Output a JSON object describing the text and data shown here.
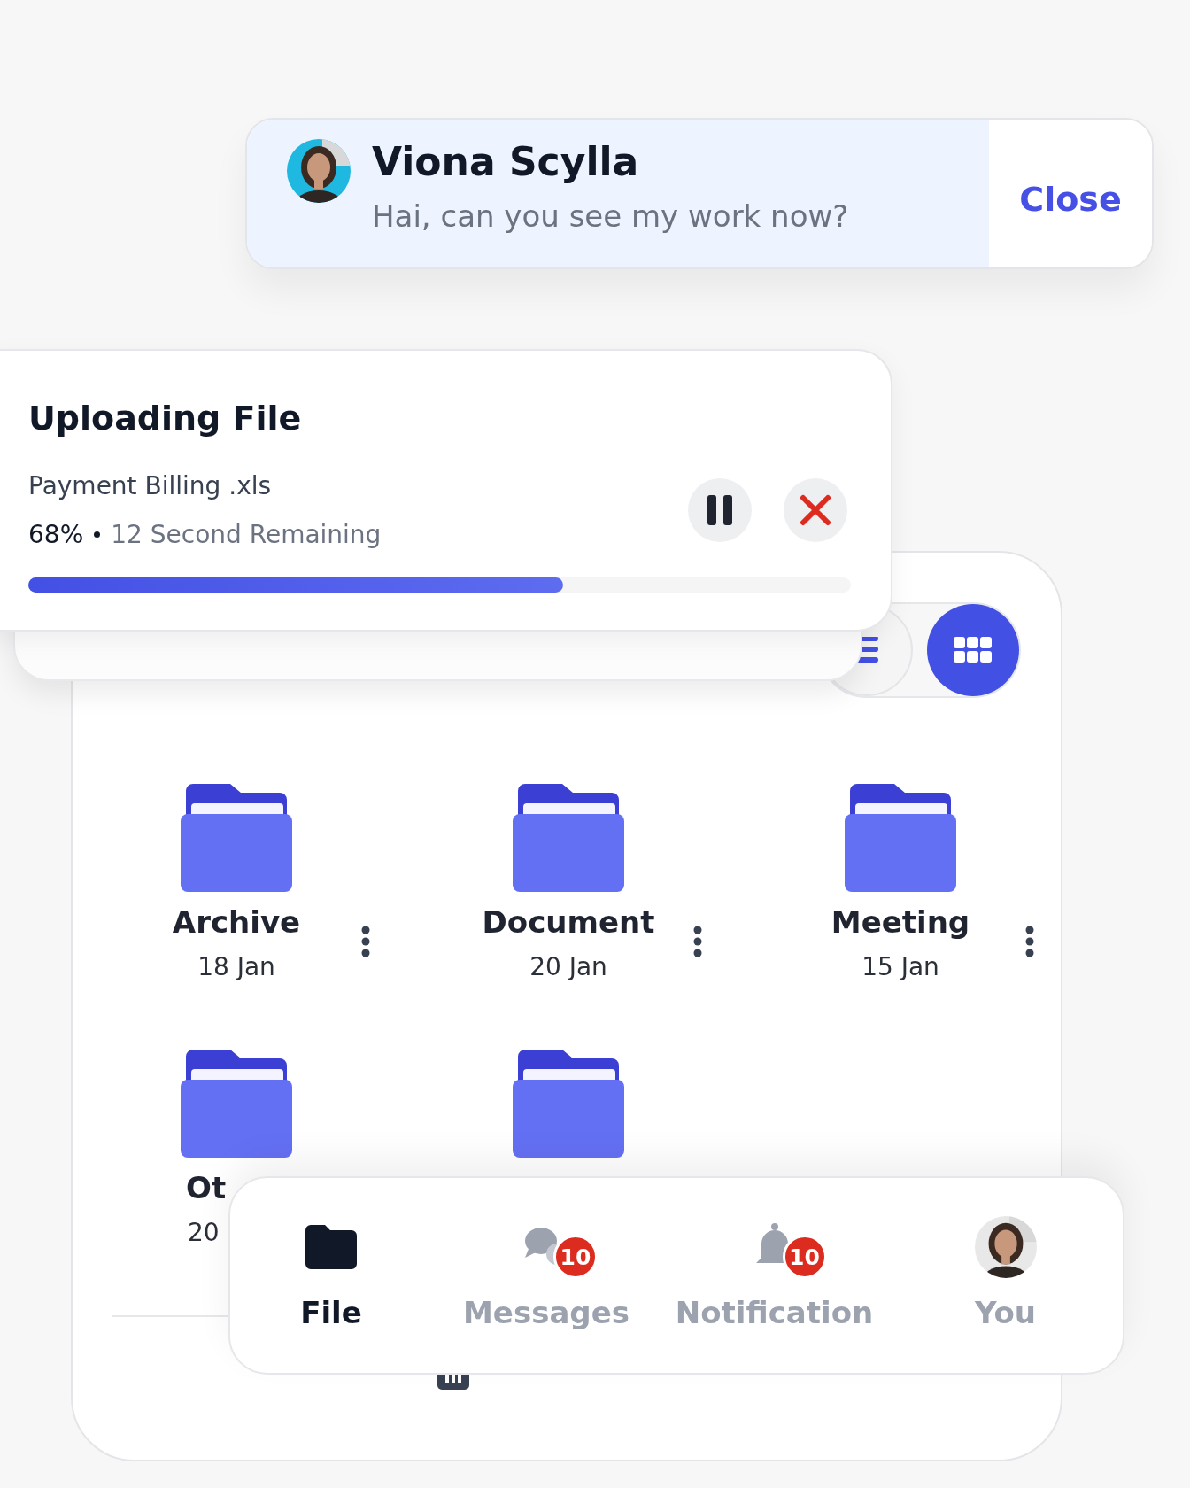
{
  "notification": {
    "sender": "Viona Scylla",
    "message": "Hai, can you see my work now?",
    "close_label": "Close"
  },
  "upload": {
    "title": "Uploading File",
    "file_name": "Payment Billing .xls",
    "percent": "68%",
    "remaining": "12 Second Remaining",
    "level": 0.65
  },
  "view_toggle": [
    {
      "kind": "list",
      "selected": false
    },
    {
      "kind": "grid",
      "selected": true
    }
  ],
  "folders": [
    {
      "kind": "folder",
      "name": "Archive",
      "date": "18 Jan"
    },
    {
      "kind": "folder",
      "name": "Document",
      "date": "20 Jan"
    },
    {
      "kind": "folder",
      "name": "Meeting",
      "date": "15 Jan"
    },
    {
      "kind": "folder",
      "name": "Ot",
      "date": "20"
    },
    {
      "kind": "folder"
    }
  ],
  "bottom_nav": [
    {
      "kind": "folder",
      "label": "File",
      "selected": true
    },
    {
      "kind": "chat",
      "label": "Messages",
      "selected": false,
      "badge": "10"
    },
    {
      "kind": "bell",
      "label": "Notification",
      "selected": false,
      "badge": "10"
    },
    {
      "kind": "avatar",
      "label": "You",
      "selected": false
    }
  ]
}
